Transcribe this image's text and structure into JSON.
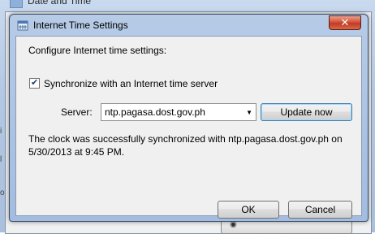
{
  "background_window": {
    "title": "Date and Time",
    "side_letters": [
      "i",
      "l",
      "o"
    ]
  },
  "dialog": {
    "title": "Internet Time Settings",
    "close_glyph": "✕",
    "heading": "Configure Internet time settings:",
    "sync_checkbox": {
      "label": "Synchronize with an Internet time server",
      "checked": true,
      "mark": "✔"
    },
    "server": {
      "label": "Server:",
      "value": "ntp.pagasa.dost.gov.ph",
      "arrow": "▼"
    },
    "update_button": "Update now",
    "status_line1": "The clock was successfully synchronized with ntp.pagasa.dost.gov.ph on",
    "status_line2": "5/30/2013 at 9:45 PM.",
    "ok_button": "OK",
    "cancel_button": "Cancel"
  },
  "colors": {
    "frame": "#a9bfdc",
    "close": "#c23a1f",
    "default_button_border": "#3c7fb1"
  }
}
